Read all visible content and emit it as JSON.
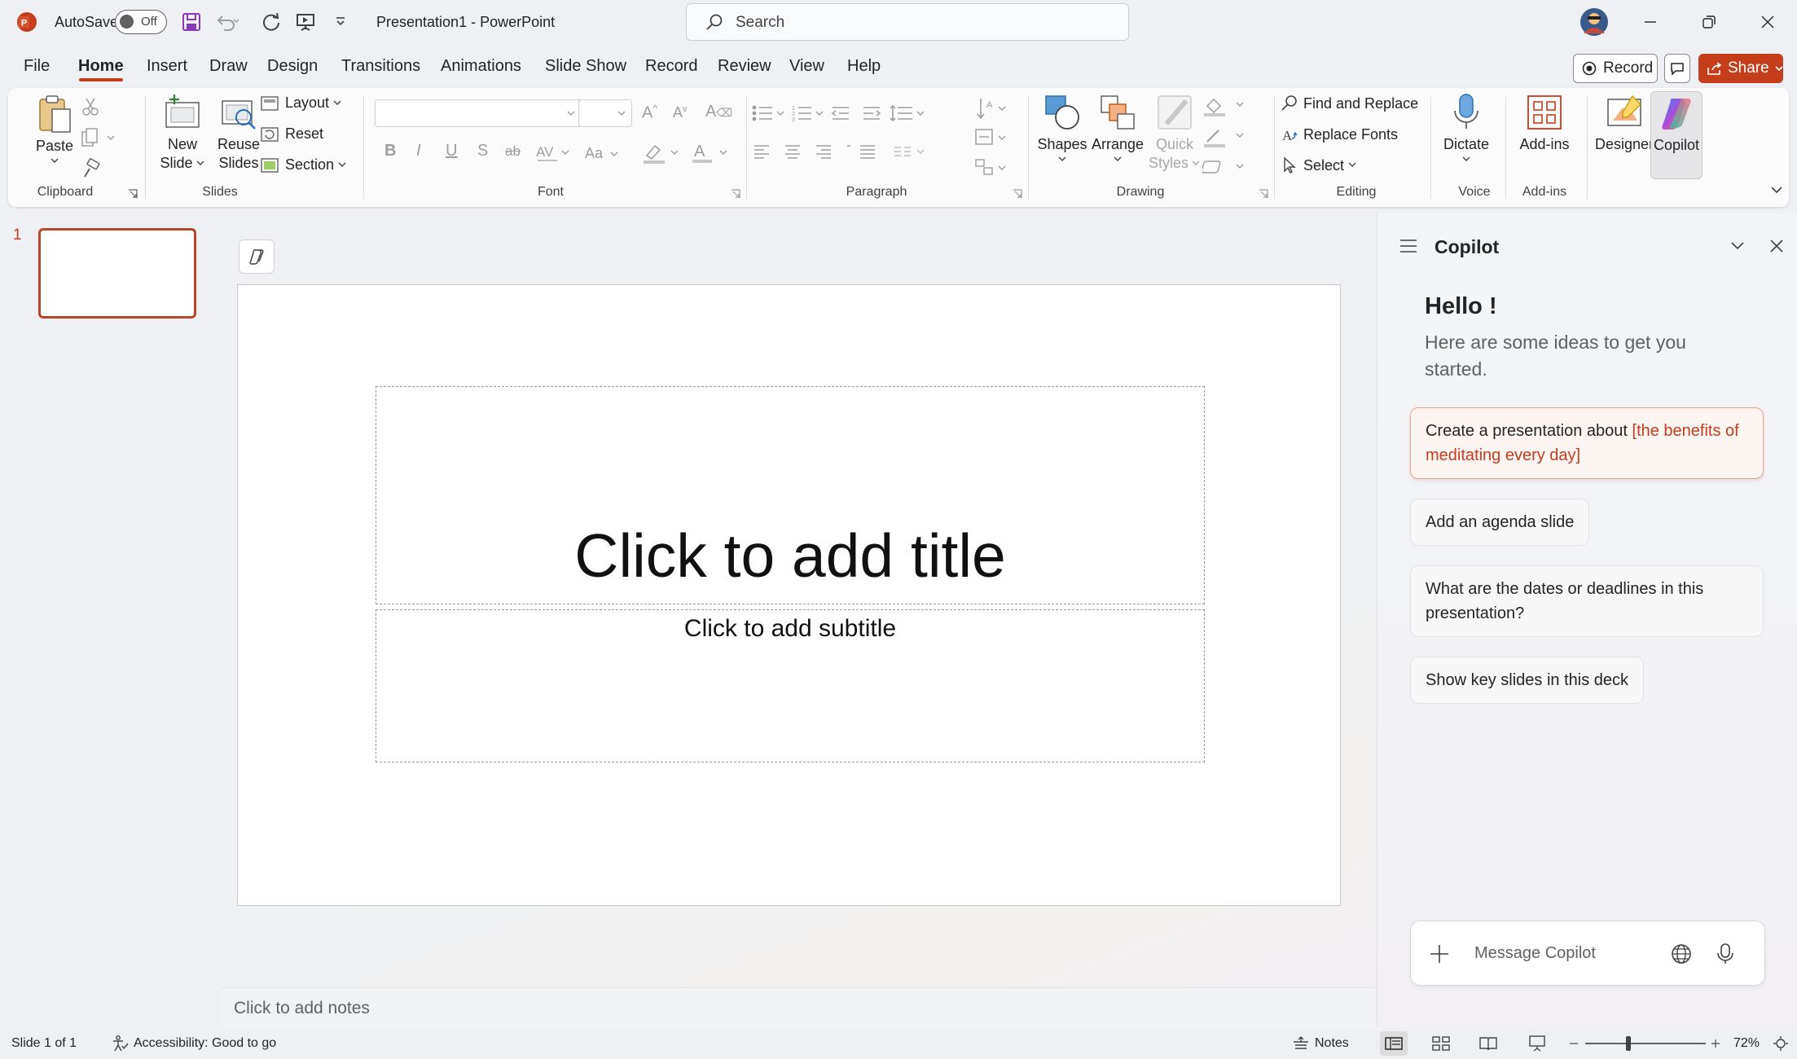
{
  "titlebar": {
    "autosave_label": "AutoSave",
    "autosave_state": "Off",
    "doc_title": "Presentation1  -  PowerPoint",
    "search_placeholder": "Search"
  },
  "tabs": [
    {
      "label": "File"
    },
    {
      "label": "Home"
    },
    {
      "label": "Insert"
    },
    {
      "label": "Draw"
    },
    {
      "label": "Design"
    },
    {
      "label": "Transitions"
    },
    {
      "label": "Animations"
    },
    {
      "label": "Slide Show"
    },
    {
      "label": "Record"
    },
    {
      "label": "Review"
    },
    {
      "label": "View"
    },
    {
      "label": "Help"
    }
  ],
  "tab_actions": {
    "record_label": "Record",
    "share_label": "Share"
  },
  "ribbon": {
    "clipboard": {
      "paste": "Paste",
      "group": "Clipboard"
    },
    "slides": {
      "new_slide_1": "New",
      "new_slide_2": "Slide",
      "reuse_1": "Reuse",
      "reuse_2": "Slides",
      "layout": "Layout",
      "reset": "Reset",
      "section": "Section",
      "group": "Slides"
    },
    "font": {
      "group": "Font",
      "bold": "B",
      "italic": "I",
      "underline": "U",
      "shadow": "S",
      "strike": "ab"
    },
    "paragraph": {
      "group": "Paragraph"
    },
    "drawing": {
      "shapes": "Shapes",
      "arrange": "Arrange",
      "quick_1": "Quick",
      "quick_2": "Styles",
      "group": "Drawing"
    },
    "editing": {
      "find": "Find and Replace",
      "replace": "Replace Fonts",
      "select": "Select",
      "group": "Editing"
    },
    "voice": {
      "dictate": "Dictate",
      "group": "Voice"
    },
    "addins": {
      "addins": "Add-ins",
      "group": "Add-ins"
    },
    "designer": "Designer",
    "copilot": "Copilot"
  },
  "thumbs": {
    "slide_number": "1"
  },
  "slide": {
    "title_placeholder": "Click to add title",
    "subtitle_placeholder": "Click to add subtitle"
  },
  "notes_placeholder": "Click to add notes",
  "copilot": {
    "title": "Copilot",
    "greeting": "Hello !",
    "intro": "Here are some ideas to get you started.",
    "suggestions": {
      "s1_prefix": "Create a presentation about ",
      "s1_topic": "[the benefits of meditating every day]",
      "s2": "Add an agenda slide",
      "s3": "What are the dates or deadlines in this presentation?",
      "s4": "Show key slides in this deck"
    },
    "message_placeholder": "Message Copilot"
  },
  "statusbar": {
    "slide_count": "Slide 1 of 1",
    "accessibility": "Accessibility: Good to go",
    "notes": "Notes",
    "zoom": "72%"
  },
  "colors": {
    "accent": "#c43e1c",
    "share_bg": "#c43e1c"
  }
}
